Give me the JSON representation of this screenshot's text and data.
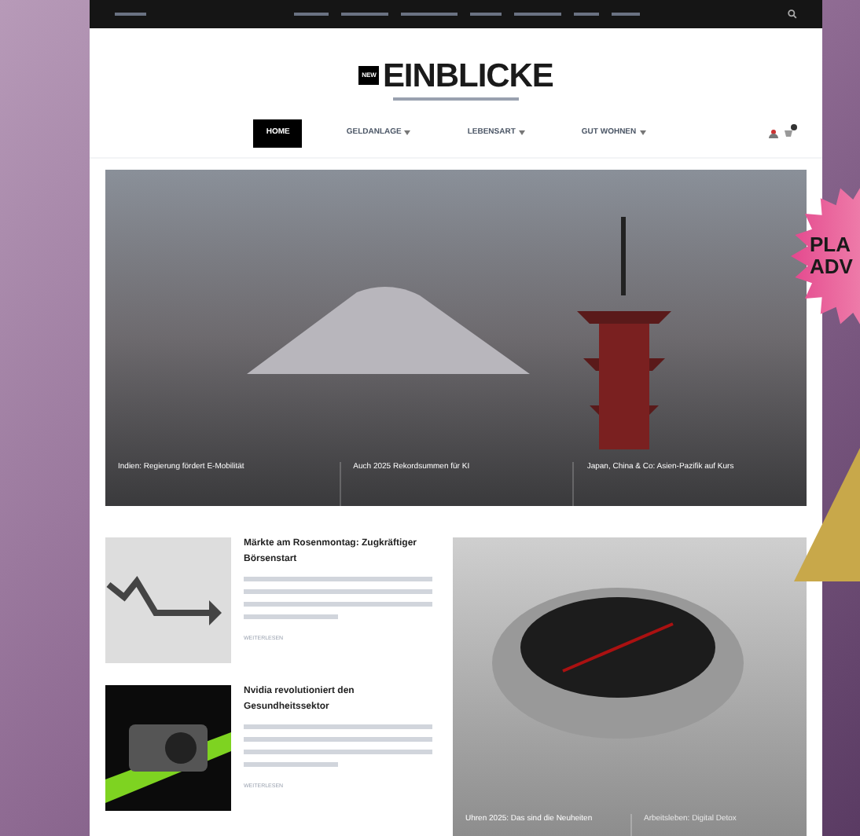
{
  "logo": {
    "badge": "NEW",
    "title": "EINBLICKE"
  },
  "nav": {
    "items": [
      {
        "label": "HOME",
        "selected": true,
        "dropdown": false
      },
      {
        "label": "GELDANLAGE",
        "selected": false,
        "dropdown": true
      },
      {
        "label": "LEBENSART",
        "selected": false,
        "dropdown": true
      },
      {
        "label": "GUT WOHNEN",
        "selected": false,
        "dropdown": true
      }
    ]
  },
  "hero": {
    "captions": [
      "Indien: Regierung fördert E-Mobilität",
      "Auch 2025 Rekordsummen für KI",
      "Japan, China & Co: Asien-Pazifik auf Kurs"
    ]
  },
  "articles": [
    {
      "kind": "chart",
      "title": "Märkte am Rosenmontag: Zugkräftiger Börsenstart",
      "more": "WEITERLESEN"
    },
    {
      "kind": "gpu",
      "title": "Nvidia revolutioniert den Gesundheitssektor",
      "more": "WEITERLESEN"
    }
  ],
  "feature": {
    "captions": [
      "Uhren 2025: Das sind die Neuheiten",
      "Arbeitsleben: Digital Detox"
    ]
  },
  "burst": {
    "lines": [
      "PLA",
      "ADV"
    ]
  }
}
